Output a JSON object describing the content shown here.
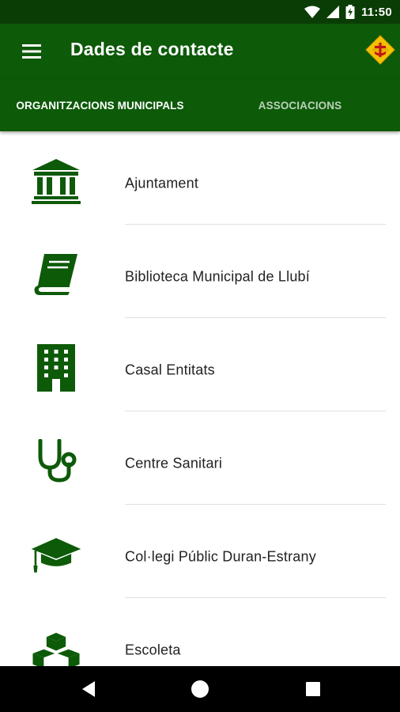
{
  "status_bar": {
    "time": "11:50",
    "icons": [
      "wifi-icon",
      "signal-icon",
      "battery-charging-icon"
    ]
  },
  "app_bar": {
    "title": "Dades de contacte",
    "menu_icon": "hamburger-menu-icon",
    "logo": "municipal-shield-logo"
  },
  "tabs": [
    {
      "label": "ORGANITZACIONS MUNICIPALS",
      "selected": true
    },
    {
      "label": "ASSOCIACIONS",
      "selected": false
    }
  ],
  "list": {
    "items": [
      {
        "label": "Ajuntament",
        "icon": "town-hall-icon"
      },
      {
        "label": "Biblioteca Municipal de Llubí",
        "icon": "book-icon"
      },
      {
        "label": "Casal Entitats",
        "icon": "building-icon"
      },
      {
        "label": "Centre Sanitari",
        "icon": "stethoscope-icon"
      },
      {
        "label": "Col·legi Públic Duran-Estrany",
        "icon": "graduation-cap-icon"
      },
      {
        "label": "Escoleta",
        "icon": "toy-blocks-icon"
      }
    ]
  },
  "nav_bar": {
    "buttons": [
      "back-icon",
      "home-icon",
      "recents-icon"
    ]
  },
  "colors": {
    "status_bar": "#0a3d05",
    "primary": "#0d5a09",
    "icon": "#0d5a09",
    "text": "#222222",
    "divider": "#e0e0e0"
  }
}
